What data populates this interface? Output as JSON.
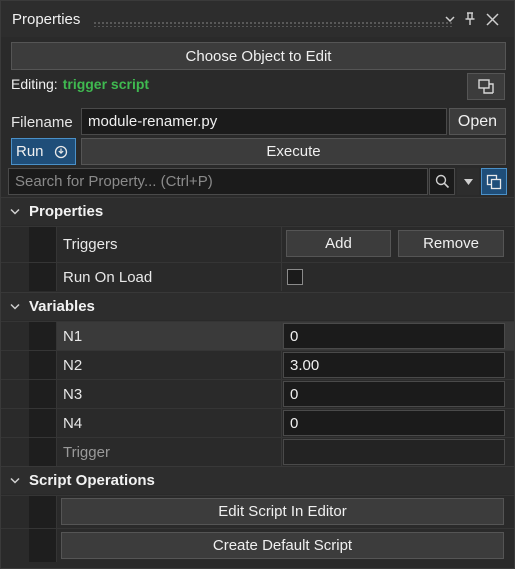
{
  "window": {
    "title": "Properties"
  },
  "toolbar": {
    "choose_object_label": "Choose Object to Edit",
    "editing_label": "Editing:",
    "editing_target": "trigger script",
    "filename_label": "Filename",
    "filename_value": "module-renamer.py",
    "open_label": "Open",
    "run_label": "Run",
    "execute_label": "Execute",
    "search_placeholder": "Search for Property... (Ctrl+P)"
  },
  "sections": {
    "properties": {
      "title": "Properties",
      "triggers_label": "Triggers",
      "add_label": "Add",
      "remove_label": "Remove",
      "run_on_load_label": "Run On Load",
      "run_on_load_checked": false
    },
    "variables": {
      "title": "Variables",
      "items": [
        {
          "name": "N1",
          "value": "0"
        },
        {
          "name": "N2",
          "value": "3.00"
        },
        {
          "name": "N3",
          "value": "0"
        },
        {
          "name": "N4",
          "value": "0"
        },
        {
          "name": "Trigger",
          "value": ""
        }
      ]
    },
    "script_operations": {
      "title": "Script Operations",
      "edit_label": "Edit Script In Editor",
      "create_label": "Create Default Script"
    }
  },
  "colors": {
    "accent_green": "#3fb950",
    "selected_blue": "#1f4e79"
  }
}
